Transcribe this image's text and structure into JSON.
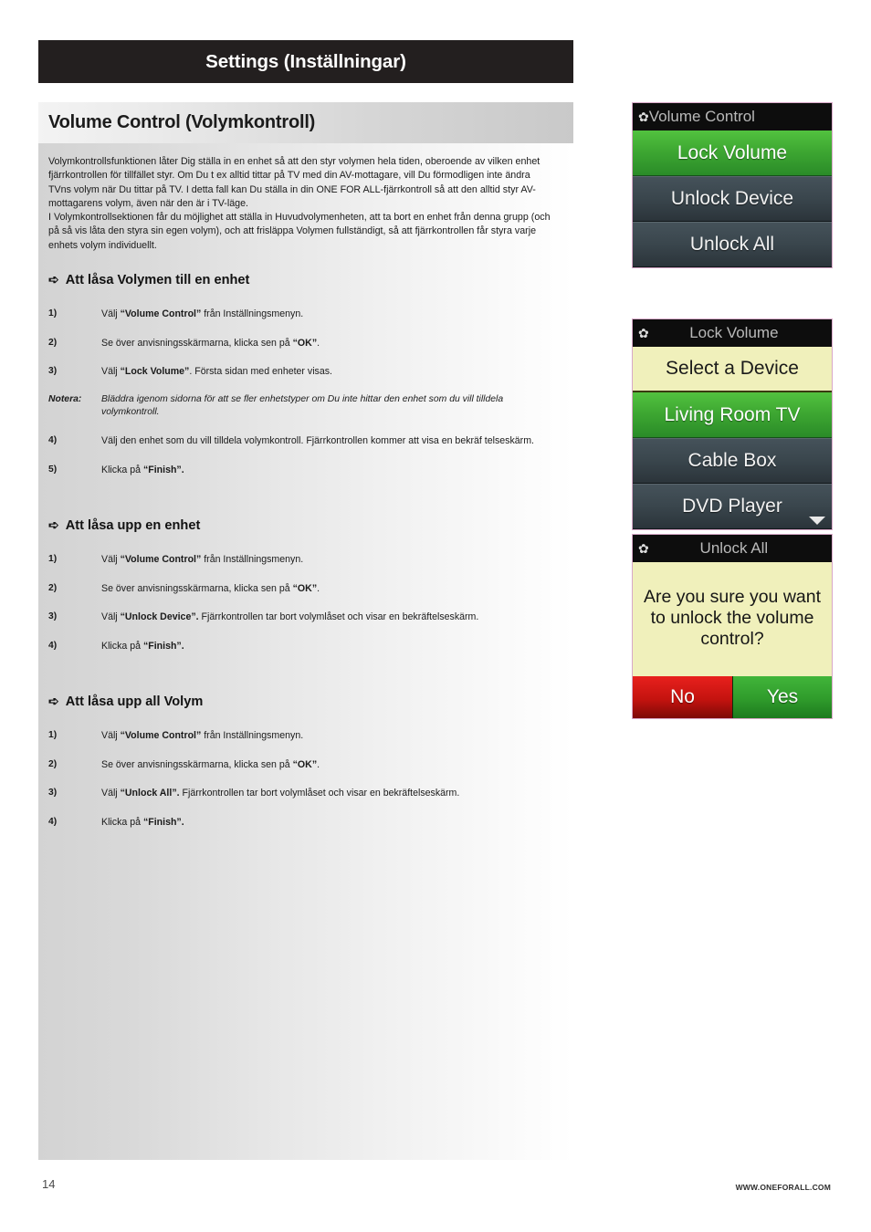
{
  "page": {
    "title": "Settings (Inställningar)",
    "section_heading": "Volume Control (Volymkontroll)",
    "footer_page_number": "14",
    "footer_url": "WWW.ONEFORALL.COM"
  },
  "intro": {
    "paragraph1": "Volymkontrollsfunktionen låter Dig ställa in en enhet så att den styr volymen hela tiden, oberoende av vilken enhet fjärrkontrollen för tillfället styr.  Om Du t ex alltid tittar på TV med din AV-mottagare, vill Du förmodligen inte ändra TVns volym när Du tittar på TV. I detta fall kan Du ställa in din ONE FOR ALL-fjärrkontroll så att den alltid styr AV-mottagarens volym, även när den är i TV-läge.",
    "paragraph2": "I Volymkontrollsektionen får du möjlighet att ställa in Huvudvolymenheten, att ta bort en enhet från denna grupp (och på så vis låta den styra sin egen volym), och att frisläppa Volymen fullständigt, så att fjärrkontrollen får styra varje enhets volym individuellt."
  },
  "sections": [
    {
      "bullet": "➪",
      "title": "Att låsa Volymen till en enhet",
      "steps": [
        {
          "num": "1)",
          "prefix": "Välj ",
          "bold": "“Volume Control”",
          "suffix": " från Inställningsmenyn."
        },
        {
          "num": "2)",
          "prefix": "Se över anvisningsskärmarna, klicka sen på ",
          "bold": "“OK”",
          "suffix": "."
        },
        {
          "num": "3)",
          "prefix": "Välj ",
          "bold": "“Lock Volume”",
          "suffix": ". Första sidan med enheter visas."
        }
      ],
      "note": {
        "label": "Notera",
        "separator": ":",
        "text": "Bläddra igenom sidorna för att se fler enhetstyper om Du inte hittar den enhet som du vill tilldela volymkontroll."
      },
      "steps_after_note": [
        {
          "num": "4)",
          "prefix": "Välj den enhet som du vill tilldela volymkontroll. Fjärrkontrollen kommer att visa en bekräf telseskärm.",
          "bold": "",
          "suffix": ""
        },
        {
          "num": "5)",
          "prefix": "Klicka på ",
          "bold": "“Finish”.",
          "suffix": ""
        }
      ]
    },
    {
      "bullet": "➪",
      "title": "Att låsa upp en enhet",
      "steps": [
        {
          "num": "1)",
          "prefix": "Välj ",
          "bold": "“Volume Control”",
          "suffix": " från Inställningsmenyn."
        },
        {
          "num": "2)",
          "prefix": "Se över anvisningsskärmarna, klicka sen på ",
          "bold": "“OK”",
          "suffix": "."
        },
        {
          "num": "3)",
          "prefix": "Välj ",
          "bold": "“Unlock Device”.",
          "suffix": " Fjärrkontrollen tar bort volymlåset och visar en bekräftelseskärm."
        },
        {
          "num": "4)",
          "prefix": "Klicka på ",
          "bold": "“Finish”.",
          "suffix": ""
        }
      ],
      "note": null,
      "steps_after_note": []
    },
    {
      "bullet": "➪",
      "title": "Att låsa upp all Volym",
      "steps": [
        {
          "num": "1)",
          "prefix": "Välj ",
          "bold": "“Volume Control”",
          "suffix": " från Inställningsmenyn."
        },
        {
          "num": "2)",
          "prefix": "Se över anvisningsskärmarna, klicka sen på ",
          "bold": "“OK”",
          "suffix": "."
        },
        {
          "num": "3)",
          "prefix": "Välj ",
          "bold": "“Unlock All”.",
          "suffix": " Fjärrkontrollen tar bort volymlåset och visar en bekräftelseskärm."
        },
        {
          "num": "4)",
          "prefix": "Klicka på ",
          "bold": "“Finish”.",
          "suffix": ""
        }
      ],
      "note": null,
      "steps_after_note": []
    }
  ],
  "screens": {
    "screen1": {
      "header_icon": "gear-icon",
      "header_glyph": "✿",
      "header_label": "Volume Control",
      "rows": [
        {
          "label": "Lock Volume",
          "style": "green"
        },
        {
          "label": "Unlock Device",
          "style": "dark"
        },
        {
          "label": "Unlock All",
          "style": "dark"
        }
      ]
    },
    "screen2": {
      "header_icon": "gear-icon",
      "header_glyph": "✿",
      "header_label": "Lock Volume",
      "rows": [
        {
          "label": "Select a Device",
          "style": "yellow"
        },
        {
          "label": "Living Room TV",
          "style": "green"
        },
        {
          "label": "Cable Box",
          "style": "dark"
        },
        {
          "label": "DVD Player",
          "style": "dark",
          "chevron": "chevron-down-icon"
        }
      ]
    },
    "screen3": {
      "header_icon": "gear-icon",
      "header_glyph": "✿",
      "header_label": "Unlock All",
      "confirm_text": "Are you sure you want to unlock the volume control?",
      "button_no": "No",
      "button_yes": "Yes"
    }
  },
  "colors": {
    "title_bar": "#231f1f",
    "green": "#3ea832",
    "dark_row": "#3a464d",
    "yellow": "#f0f0bb",
    "red": "#c4130f"
  }
}
